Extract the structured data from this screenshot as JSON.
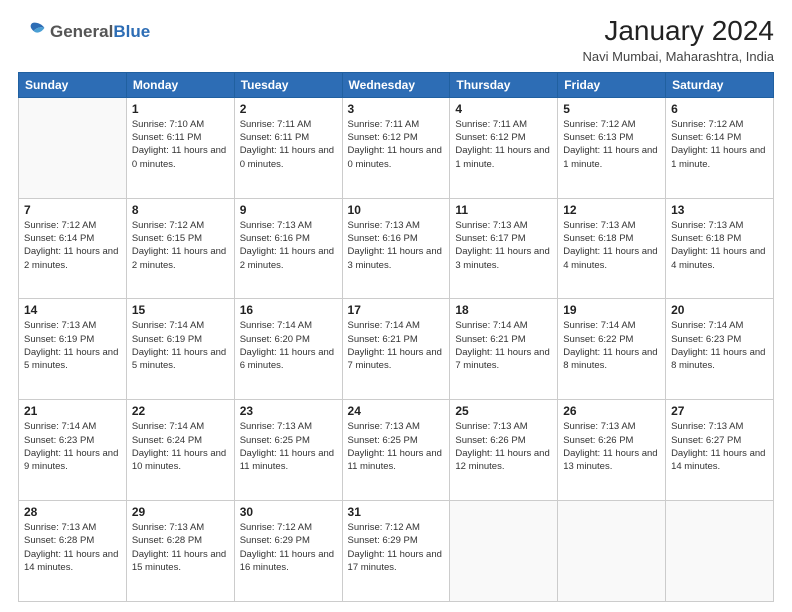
{
  "header": {
    "logo_general": "General",
    "logo_blue": "Blue",
    "title": "January 2024",
    "subtitle": "Navi Mumbai, Maharashtra, India"
  },
  "days_of_week": [
    "Sunday",
    "Monday",
    "Tuesday",
    "Wednesday",
    "Thursday",
    "Friday",
    "Saturday"
  ],
  "weeks": [
    [
      {
        "day": "",
        "sunrise": "",
        "sunset": "",
        "daylight": ""
      },
      {
        "day": "1",
        "sunrise": "Sunrise: 7:10 AM",
        "sunset": "Sunset: 6:11 PM",
        "daylight": "Daylight: 11 hours and 0 minutes."
      },
      {
        "day": "2",
        "sunrise": "Sunrise: 7:11 AM",
        "sunset": "Sunset: 6:11 PM",
        "daylight": "Daylight: 11 hours and 0 minutes."
      },
      {
        "day": "3",
        "sunrise": "Sunrise: 7:11 AM",
        "sunset": "Sunset: 6:12 PM",
        "daylight": "Daylight: 11 hours and 0 minutes."
      },
      {
        "day": "4",
        "sunrise": "Sunrise: 7:11 AM",
        "sunset": "Sunset: 6:12 PM",
        "daylight": "Daylight: 11 hours and 1 minute."
      },
      {
        "day": "5",
        "sunrise": "Sunrise: 7:12 AM",
        "sunset": "Sunset: 6:13 PM",
        "daylight": "Daylight: 11 hours and 1 minute."
      },
      {
        "day": "6",
        "sunrise": "Sunrise: 7:12 AM",
        "sunset": "Sunset: 6:14 PM",
        "daylight": "Daylight: 11 hours and 1 minute."
      }
    ],
    [
      {
        "day": "7",
        "sunrise": "Sunrise: 7:12 AM",
        "sunset": "Sunset: 6:14 PM",
        "daylight": "Daylight: 11 hours and 2 minutes."
      },
      {
        "day": "8",
        "sunrise": "Sunrise: 7:12 AM",
        "sunset": "Sunset: 6:15 PM",
        "daylight": "Daylight: 11 hours and 2 minutes."
      },
      {
        "day": "9",
        "sunrise": "Sunrise: 7:13 AM",
        "sunset": "Sunset: 6:16 PM",
        "daylight": "Daylight: 11 hours and 2 minutes."
      },
      {
        "day": "10",
        "sunrise": "Sunrise: 7:13 AM",
        "sunset": "Sunset: 6:16 PM",
        "daylight": "Daylight: 11 hours and 3 minutes."
      },
      {
        "day": "11",
        "sunrise": "Sunrise: 7:13 AM",
        "sunset": "Sunset: 6:17 PM",
        "daylight": "Daylight: 11 hours and 3 minutes."
      },
      {
        "day": "12",
        "sunrise": "Sunrise: 7:13 AM",
        "sunset": "Sunset: 6:18 PM",
        "daylight": "Daylight: 11 hours and 4 minutes."
      },
      {
        "day": "13",
        "sunrise": "Sunrise: 7:13 AM",
        "sunset": "Sunset: 6:18 PM",
        "daylight": "Daylight: 11 hours and 4 minutes."
      }
    ],
    [
      {
        "day": "14",
        "sunrise": "Sunrise: 7:13 AM",
        "sunset": "Sunset: 6:19 PM",
        "daylight": "Daylight: 11 hours and 5 minutes."
      },
      {
        "day": "15",
        "sunrise": "Sunrise: 7:14 AM",
        "sunset": "Sunset: 6:19 PM",
        "daylight": "Daylight: 11 hours and 5 minutes."
      },
      {
        "day": "16",
        "sunrise": "Sunrise: 7:14 AM",
        "sunset": "Sunset: 6:20 PM",
        "daylight": "Daylight: 11 hours and 6 minutes."
      },
      {
        "day": "17",
        "sunrise": "Sunrise: 7:14 AM",
        "sunset": "Sunset: 6:21 PM",
        "daylight": "Daylight: 11 hours and 7 minutes."
      },
      {
        "day": "18",
        "sunrise": "Sunrise: 7:14 AM",
        "sunset": "Sunset: 6:21 PM",
        "daylight": "Daylight: 11 hours and 7 minutes."
      },
      {
        "day": "19",
        "sunrise": "Sunrise: 7:14 AM",
        "sunset": "Sunset: 6:22 PM",
        "daylight": "Daylight: 11 hours and 8 minutes."
      },
      {
        "day": "20",
        "sunrise": "Sunrise: 7:14 AM",
        "sunset": "Sunset: 6:23 PM",
        "daylight": "Daylight: 11 hours and 8 minutes."
      }
    ],
    [
      {
        "day": "21",
        "sunrise": "Sunrise: 7:14 AM",
        "sunset": "Sunset: 6:23 PM",
        "daylight": "Daylight: 11 hours and 9 minutes."
      },
      {
        "day": "22",
        "sunrise": "Sunrise: 7:14 AM",
        "sunset": "Sunset: 6:24 PM",
        "daylight": "Daylight: 11 hours and 10 minutes."
      },
      {
        "day": "23",
        "sunrise": "Sunrise: 7:13 AM",
        "sunset": "Sunset: 6:25 PM",
        "daylight": "Daylight: 11 hours and 11 minutes."
      },
      {
        "day": "24",
        "sunrise": "Sunrise: 7:13 AM",
        "sunset": "Sunset: 6:25 PM",
        "daylight": "Daylight: 11 hours and 11 minutes."
      },
      {
        "day": "25",
        "sunrise": "Sunrise: 7:13 AM",
        "sunset": "Sunset: 6:26 PM",
        "daylight": "Daylight: 11 hours and 12 minutes."
      },
      {
        "day": "26",
        "sunrise": "Sunrise: 7:13 AM",
        "sunset": "Sunset: 6:26 PM",
        "daylight": "Daylight: 11 hours and 13 minutes."
      },
      {
        "day": "27",
        "sunrise": "Sunrise: 7:13 AM",
        "sunset": "Sunset: 6:27 PM",
        "daylight": "Daylight: 11 hours and 14 minutes."
      }
    ],
    [
      {
        "day": "28",
        "sunrise": "Sunrise: 7:13 AM",
        "sunset": "Sunset: 6:28 PM",
        "daylight": "Daylight: 11 hours and 14 minutes."
      },
      {
        "day": "29",
        "sunrise": "Sunrise: 7:13 AM",
        "sunset": "Sunset: 6:28 PM",
        "daylight": "Daylight: 11 hours and 15 minutes."
      },
      {
        "day": "30",
        "sunrise": "Sunrise: 7:12 AM",
        "sunset": "Sunset: 6:29 PM",
        "daylight": "Daylight: 11 hours and 16 minutes."
      },
      {
        "day": "31",
        "sunrise": "Sunrise: 7:12 AM",
        "sunset": "Sunset: 6:29 PM",
        "daylight": "Daylight: 11 hours and 17 minutes."
      },
      {
        "day": "",
        "sunrise": "",
        "sunset": "",
        "daylight": ""
      },
      {
        "day": "",
        "sunrise": "",
        "sunset": "",
        "daylight": ""
      },
      {
        "day": "",
        "sunrise": "",
        "sunset": "",
        "daylight": ""
      }
    ]
  ]
}
